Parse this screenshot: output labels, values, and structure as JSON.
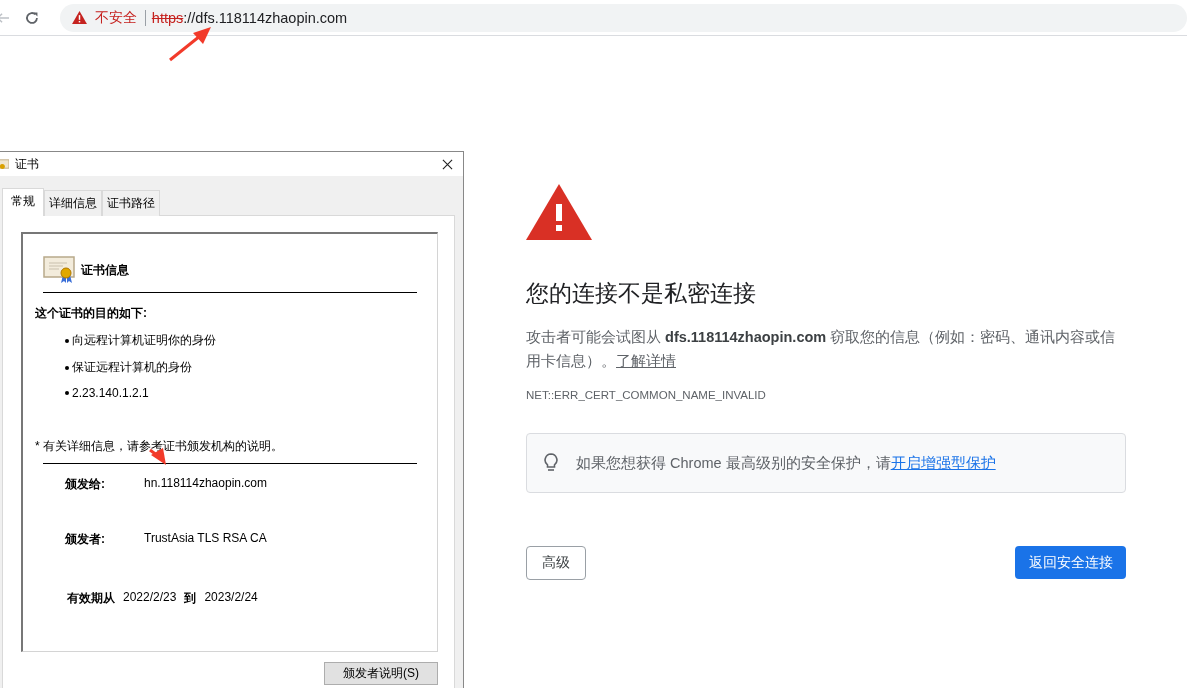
{
  "browser": {
    "back_disabled": true,
    "security_label": "不安全",
    "url_scheme": "https",
    "url_rest": "://dfs.118114zhaopin.com"
  },
  "interstitial": {
    "title": "您的连接不是私密连接",
    "description": "攻击者可能会试图从 **dfs.118114zhaopin.com** 窃取您的信息（例如：密码、通讯内容或信用卡信息）。",
    "learn_more_link": "了解详情",
    "error_code": "NET::ERR_CERT_COMMON_NAME_INVALID",
    "tip_text": "如果您想获得 Chrome 最高级别的安全保护，请",
    "tip_link": "开启增强型保护",
    "advanced_button": "高级",
    "back_button": "返回安全连接"
  },
  "dialog": {
    "title": "证书",
    "tabs": [
      {
        "label": "常规",
        "selected": true
      },
      {
        "label": "详细信息",
        "selected": false
      },
      {
        "label": "证书路径",
        "selected": false
      }
    ],
    "heading": "证书信息",
    "purpose_heading": "这个证书的目的如下:",
    "purposes": [
      "向远程计算机证明你的身份",
      "保证远程计算机的身份",
      "2.23.140.1.2.1"
    ],
    "note": "* 有关详细信息，请参考证书颁发机构的说明。",
    "issued_to_label": "颁发给:",
    "issued_to": "hn.118114zhaopin.com",
    "issued_by_label": "颁发者:",
    "issued_by": "TrustAsia TLS RSA CA",
    "valid_from_label": "有效期从",
    "valid_from": "2022/2/23",
    "valid_to_label": "到",
    "valid_to": "2023/2/24",
    "issuer_statement_button": "颁发者说明(S)"
  }
}
